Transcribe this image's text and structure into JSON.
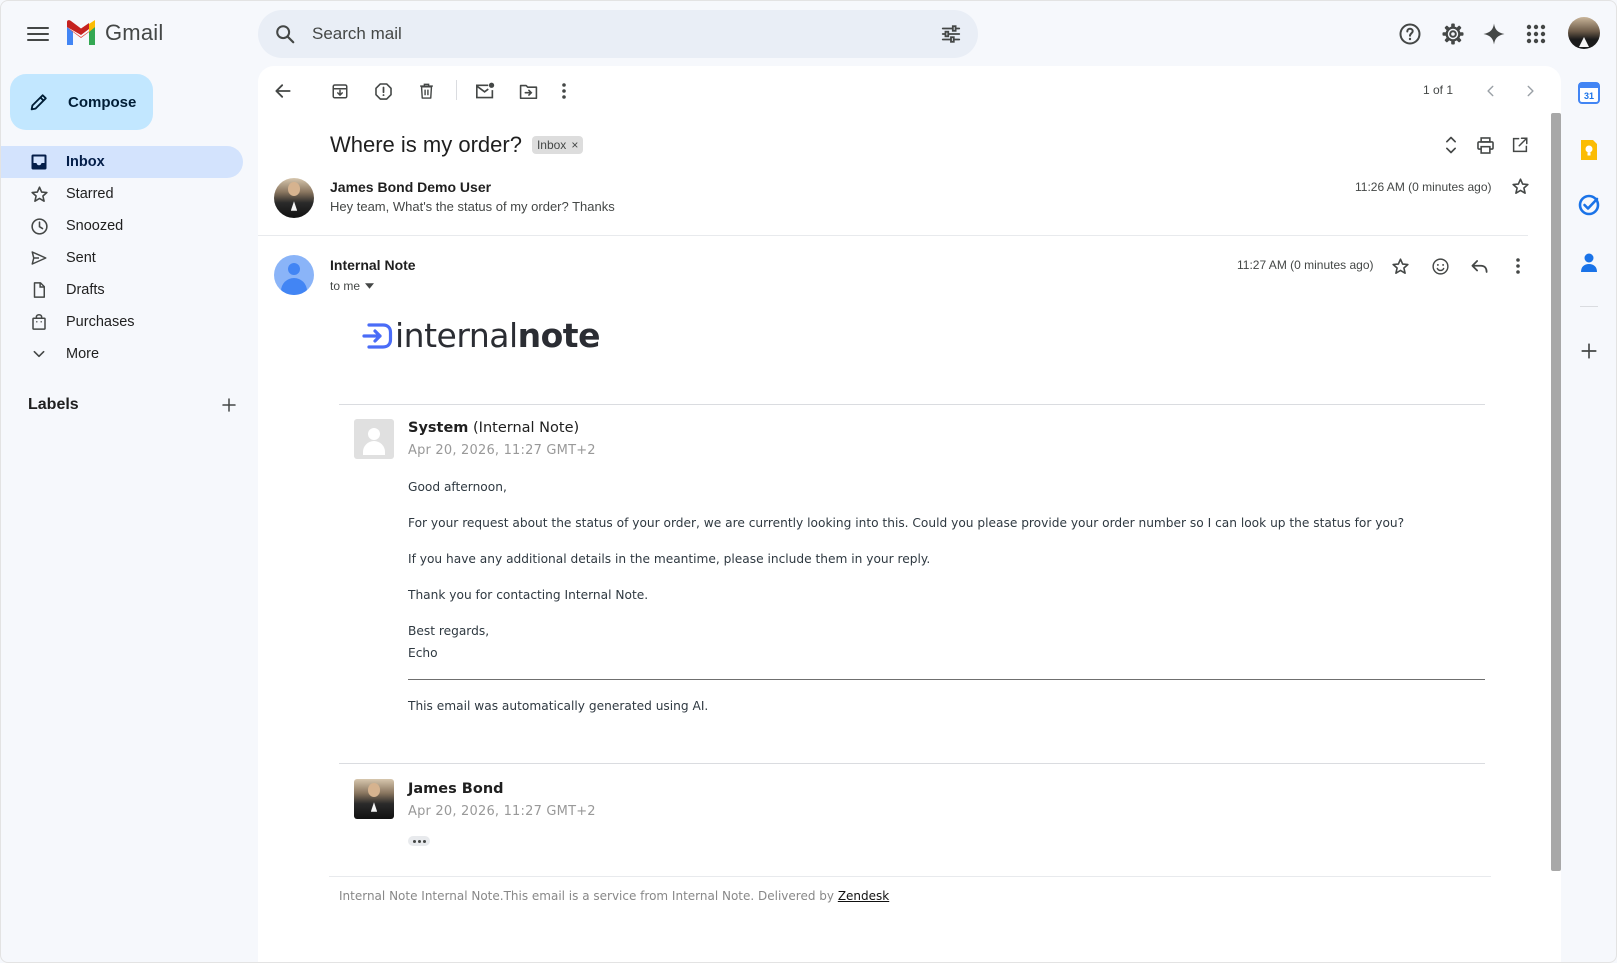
{
  "app": {
    "name": "Gmail",
    "brand_colors": {
      "red": "#ea4335",
      "blue": "#4285f4",
      "green": "#34a853",
      "yellow": "#fbbc04"
    }
  },
  "search": {
    "placeholder": "Search mail",
    "value": ""
  },
  "sidebar": {
    "compose_label": "Compose",
    "items": [
      {
        "label": "Inbox",
        "icon": "inbox-icon",
        "active": true
      },
      {
        "label": "Starred",
        "icon": "star-icon",
        "active": false
      },
      {
        "label": "Snoozed",
        "icon": "clock-icon",
        "active": false
      },
      {
        "label": "Sent",
        "icon": "send-icon",
        "active": false
      },
      {
        "label": "Drafts",
        "icon": "draft-icon",
        "active": false
      },
      {
        "label": "Purchases",
        "icon": "shopping-bag-icon",
        "active": false
      },
      {
        "label": "More",
        "icon": "chevron-down-icon",
        "active": false
      }
    ],
    "labels_title": "Labels"
  },
  "toolbar": {
    "pager": "1 of 1"
  },
  "thread": {
    "subject": "Where is my order?",
    "label_badge": "Inbox",
    "messages": [
      {
        "sender": "James Bond Demo User",
        "snippet": "Hey team, What's the status of my order? Thanks",
        "time": "11:26 AM (0 minutes ago)"
      },
      {
        "sender": "Internal Note",
        "recipient": "to me",
        "time": "11:27 AM (0 minutes ago)"
      }
    ]
  },
  "email_body": {
    "logo_text_regular": "internal",
    "logo_text_bold": "note",
    "system_card": {
      "name_bold": "System",
      "name_suffix": " (Internal Note)",
      "date": "Apr 20, 2026, 11:27 GMT+2",
      "paragraphs": [
        "Good afternoon,",
        "For your request about the status of your order, we are currently looking into this. Could you please provide your order number so I can look up the status for you?",
        "If you have any additional details in the meantime, please include them in your reply.",
        "Thank you for contacting Internal Note.",
        "Best regards,",
        "Echo"
      ],
      "ai_notice": "This email was automatically generated using AI."
    },
    "reply_card": {
      "name": "James Bond",
      "date": "Apr 20, 2026, 11:27 GMT+2"
    },
    "footer_prefix": "Internal Note Internal Note.This email is a service from Internal Note. Delivered by ",
    "footer_link": "Zendesk"
  }
}
